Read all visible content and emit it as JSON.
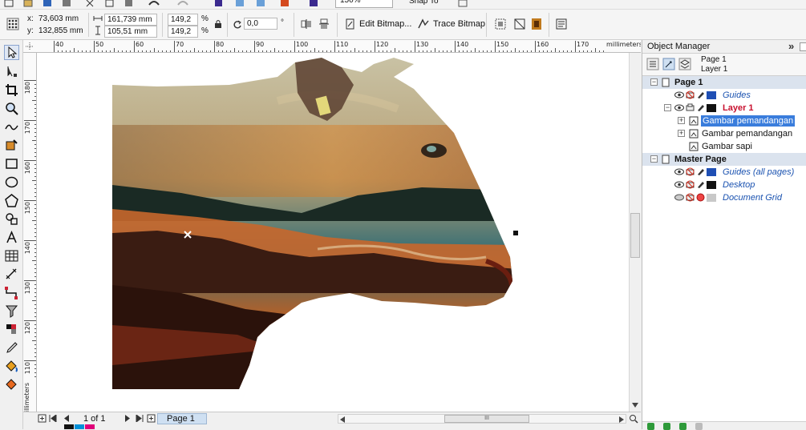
{
  "toolbar": {
    "zoom_value": "150%",
    "snap_label": "Snap To"
  },
  "props": {
    "x_label": "x:",
    "x_value": "73,603 mm",
    "y_label": "y:",
    "y_value": "132,855 mm",
    "w_value": "161,739 mm",
    "h_value": "105,51 mm",
    "scale_w": "149,2",
    "scale_h": "149,2",
    "percent": "%",
    "percent2": "%",
    "rotation": "0,0",
    "degree": "°",
    "edit_bitmap": "Edit Bitmap...",
    "trace_bitmap": "Trace Bitmap"
  },
  "ruler": {
    "h_ticks": [
      "40",
      "50",
      "60",
      "70",
      "80",
      "90",
      "100",
      "110",
      "120",
      "130",
      "140",
      "150",
      "160",
      "170"
    ],
    "h_unit": "millimeters",
    "v_ticks": [
      "180",
      "170",
      "160",
      "150",
      "140",
      "130",
      "120",
      "110"
    ],
    "v_unit": "millimeters"
  },
  "bottom": {
    "page_count": "1 of 1",
    "page_tab": "Page 1",
    "scroll_grip": "III"
  },
  "docker": {
    "title": "Object Manager",
    "current_page": "Page 1",
    "current_layer": "Layer 1",
    "tree": [
      {
        "label": "Page 1",
        "type": "page"
      },
      {
        "label": "Guides",
        "type": "layer",
        "swatch": "#1f4fb4"
      },
      {
        "label": "Layer 1",
        "type": "layer-active",
        "swatch": "#111111"
      },
      {
        "label": "Gambar pemandangan",
        "type": "object-selected"
      },
      {
        "label": "Gambar pemandangan",
        "type": "object"
      },
      {
        "label": "Gambar sapi",
        "type": "object"
      },
      {
        "label": "Master Page",
        "type": "page"
      },
      {
        "label": "Guides (all pages)",
        "type": "master-layer",
        "swatch": "#1f4fb4"
      },
      {
        "label": "Desktop",
        "type": "master-layer",
        "swatch": "#111111"
      },
      {
        "label": "Document Grid",
        "type": "master-layer",
        "swatch": "#c8c8c8"
      }
    ]
  },
  "colors": {
    "selection": "#3a7ddc",
    "page_row": "#dbe3ee",
    "active_layer": "#c8102e",
    "blue_link": "#1a52b0"
  }
}
